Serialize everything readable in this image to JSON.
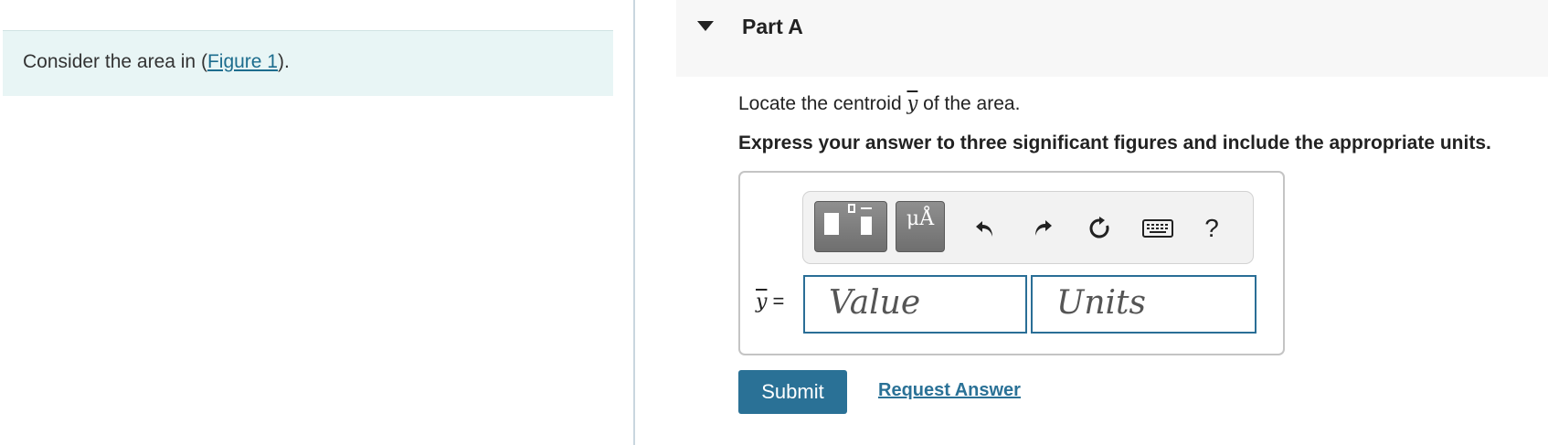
{
  "intro": {
    "text_before": "Consider the area in (",
    "figure_link": "Figure 1",
    "text_after": ")."
  },
  "part": {
    "title": "Part A"
  },
  "question": {
    "text_before": "Locate the centroid ",
    "variable": "y",
    "text_after": " of the area."
  },
  "instruction": "Express your answer to three significant figures and include the appropriate units.",
  "toolbar": {
    "units_glyph": "μÅ",
    "help": "?"
  },
  "answer": {
    "label_var": "y",
    "label_eq": " =",
    "value_placeholder": "Value",
    "units_placeholder": "Units"
  },
  "actions": {
    "submit": "Submit",
    "request_answer": "Request Answer"
  },
  "colors": {
    "intro_bg": "#e8f5f5",
    "accent": "#2a7196",
    "field_border": "#2a6e96"
  }
}
